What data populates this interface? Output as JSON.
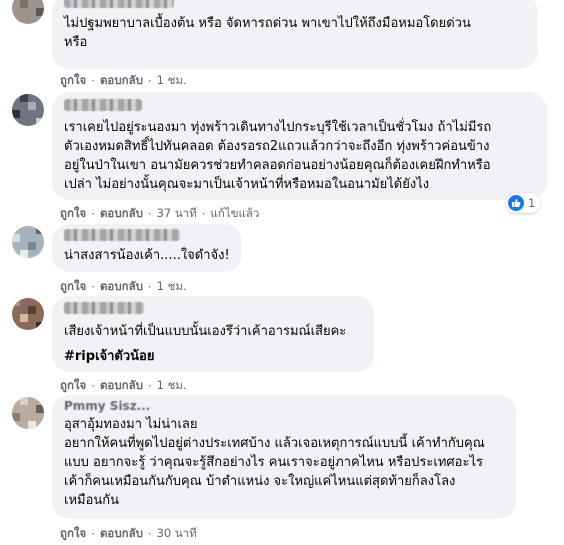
{
  "ui": {
    "like_label": "ถูกใจ",
    "reply_label": "ตอบกลับ",
    "edited_label": "แก้ไขแล้ว",
    "colors": {
      "bubble": "#f0f2f5",
      "meta": "#65676b",
      "like": "#1877f2"
    }
  },
  "comments": [
    {
      "text": "ไม่ปฐมพยาบาลเบื้องต้น หรือ จัดหารถด่วน พาเขาไปให้ถึงมือหมอโดยด่วน\nหรือ",
      "time": "1 ชม."
    },
    {
      "text": "เราเคยไปอยู่ระนองมา ทุ่งพร้าวเดินทางไปกระบุรีใช้เวลาเป็นชั่วโมง ถ้าไม่มีรถ\nตัวเองหมดสิทธิ์ไปทันคลอด ต้องรอรถ2แถวแล้วกว่าจะถึงอีก ทุ่งพร้าวค่อนข้าง\nอยู่ในป่าในเขา อนามัยควรช่วยทำคลอดก่อนอย่างน้อยคุณก็ต้องเคยฝึกทำหรือ\nเปล่า ไม่อย่างนั้นคุณจะมาเป็นเจ้าหน้าที่หรือหมอในอนามัยได้ยังไง",
      "time": "37 นาที",
      "reaction_count": "1"
    },
    {
      "text": "น่าสงสารน้องเค้า.....ใจดำจัง!",
      "time": "1 ชม."
    },
    {
      "text": "เสียงเจ้าหน้าที่เป็นแบบนั้นเองรึว่าเค้าอารมณ์เสียคะ",
      "hashtag": "#ripเจ้าตัวน้อย",
      "time": "1 ชม."
    },
    {
      "name": "Pmmy Sisz...",
      "text": "อุสาอุ้มทองมา ไม่น่าเลย\nอยากให้คนที่พูดไปอยู่ต่างประเทศบ้าง แล้วเจอเหตุการณ์แบบนี้ เค้าทำกับคุณ\nแบบ อยากจะรู้ ว่าคุณจะรู้สึกอย่างไร คนเราจะอยู่ภาคไหน หรือประเทศอะไร\nเค้าก็คนเหมือนกันกับคุณ บ้าตำแหน่ง จะใหญ่แค่ไหนแต่สุดท้ายก็ลงโลง\nเหมือนกัน",
      "time": "30 นาที"
    }
  ]
}
